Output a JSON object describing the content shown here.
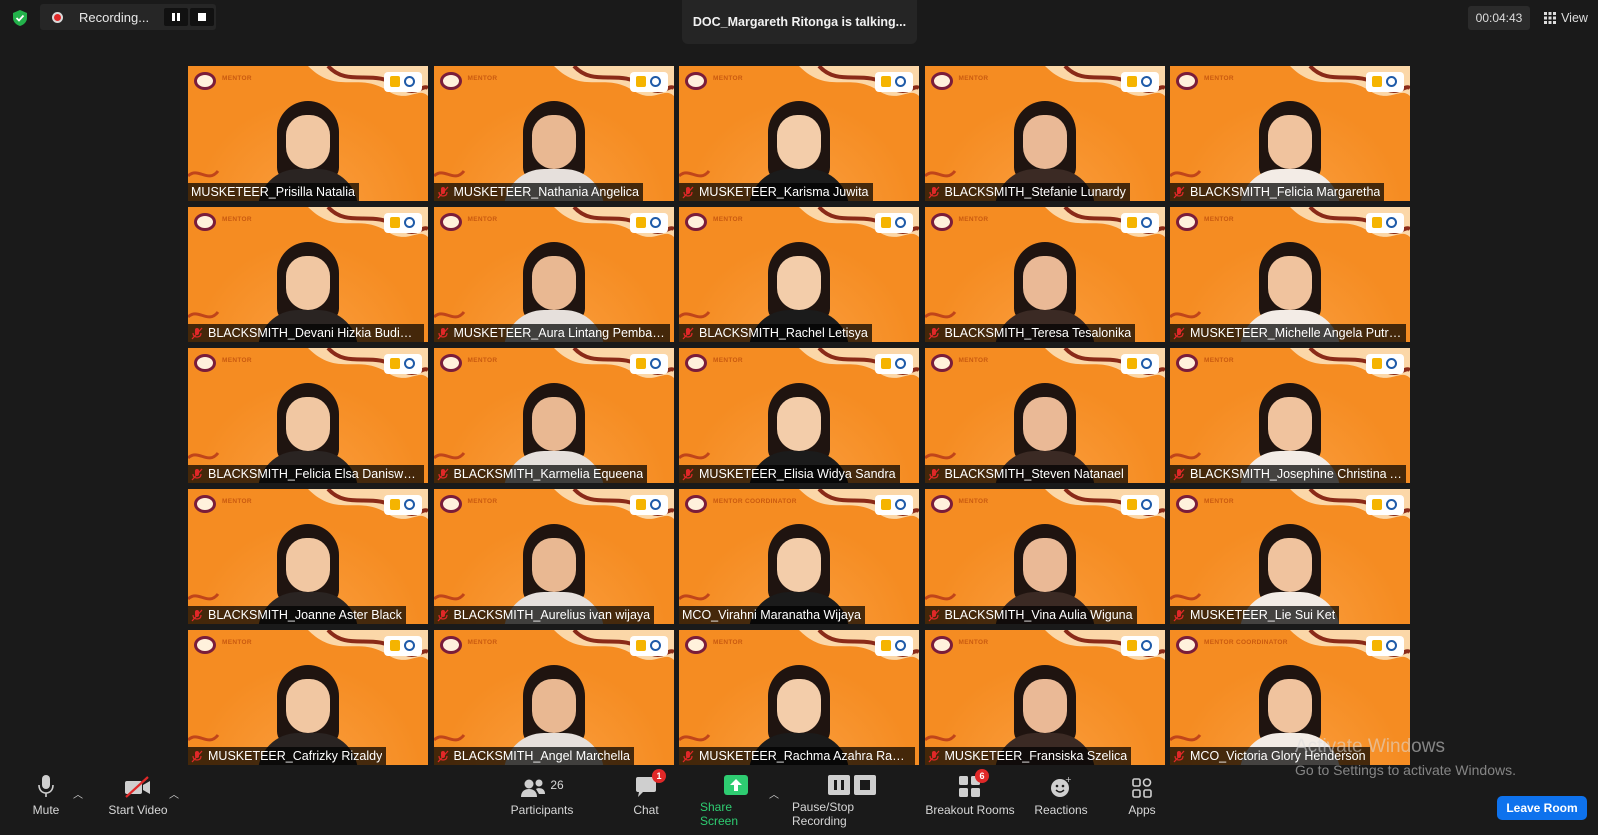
{
  "top_bar": {
    "recording_label": "Recording...",
    "talking_text": "DOC_Margareth Ritonga is talking...",
    "timer": "00:04:43",
    "view_label": "View"
  },
  "participants": [
    {
      "name": "MUSKETEER_Prisilla Natalia",
      "muted": false,
      "banner": "MENTOR"
    },
    {
      "name": "MUSKETEER_Nathania Angelica",
      "muted": true,
      "banner": "MENTOR"
    },
    {
      "name": "MUSKETEER_Karisma Juwita",
      "muted": true,
      "banner": "MENTOR"
    },
    {
      "name": "BLACKSMITH_Stefanie Lunardy",
      "muted": true,
      "banner": "MENTOR"
    },
    {
      "name": "BLACKSMITH_Felicia Margaretha",
      "muted": true,
      "banner": "MENTOR"
    },
    {
      "name": "BLACKSMITH_Devani Hizkia Budiman",
      "muted": true,
      "banner": "MENTOR"
    },
    {
      "name": "MUSKETEER_Aura Lintang Pembay...",
      "muted": true,
      "banner": "MENTOR"
    },
    {
      "name": "BLACKSMITH_Rachel Letisya",
      "muted": true,
      "banner": "MENTOR"
    },
    {
      "name": "BLACKSMITH_Teresa Tesalonika",
      "muted": true,
      "banner": "MENTOR"
    },
    {
      "name": "MUSKETEER_Michelle Angela Putri ...",
      "muted": true,
      "banner": "MENTOR"
    },
    {
      "name": "BLACKSMITH_Felicia Elsa Daniswara",
      "muted": true,
      "banner": "MENTOR"
    },
    {
      "name": "BLACKSMITH_Karmelia Equeena",
      "muted": true,
      "banner": "MENTOR"
    },
    {
      "name": "MUSKETEER_Elisia Widya Sandra",
      "muted": true,
      "banner": "MENTOR"
    },
    {
      "name": "BLACKSMITH_Steven Natanael",
      "muted": true,
      "banner": "MENTOR"
    },
    {
      "name": "BLACKSMITH_Josephine Christina A...",
      "muted": true,
      "banner": "MENTOR"
    },
    {
      "name": "BLACKSMITH_Joanne Aster Black",
      "muted": true,
      "banner": "MENTOR"
    },
    {
      "name": "BLACKSMITH_Aurelius ivan wijaya",
      "muted": true,
      "banner": "MENTOR"
    },
    {
      "name": "MCO_Virahni Maranatha Wijaya",
      "muted": false,
      "banner": "MENTOR COORDINATOR"
    },
    {
      "name": "BLACKSMITH_Vina Aulia Wiguna",
      "muted": true,
      "banner": "MENTOR"
    },
    {
      "name": "MUSKETEER_Lie Sui Ket",
      "muted": true,
      "banner": "MENTOR"
    },
    {
      "name": "MUSKETEER_Cafrizky Rizaldy",
      "muted": true,
      "banner": "MENTOR"
    },
    {
      "name": "BLACKSMITH_Angel Marchella",
      "muted": true,
      "banner": "MENTOR"
    },
    {
      "name": "MUSKETEER_Rachma Azahra Rama...",
      "muted": true,
      "banner": "MENTOR"
    },
    {
      "name": "MUSKETEER_Fransiska Szelica",
      "muted": true,
      "banner": "MENTOR"
    },
    {
      "name": "MCO_Victoria Glory Henderson",
      "muted": true,
      "banner": "MENTOR COORDINATOR"
    }
  ],
  "watermark": {
    "line1": "Activate Windows",
    "line2": "Go to Settings to activate Windows."
  },
  "toolbar": {
    "mute_label": "Mute",
    "start_video_label": "Start Video",
    "participants_label": "Participants",
    "participants_count": "26",
    "chat_label": "Chat",
    "chat_badge": "1",
    "share_label": "Share Screen",
    "recording_label": "Pause/Stop Recording",
    "breakout_label": "Breakout Rooms",
    "breakout_badge": "6",
    "reactions_label": "Reactions",
    "apps_label": "Apps",
    "leave_label": "Leave Room"
  },
  "colors": {
    "tile_bg": "#f58c22",
    "share_green": "#2ecc71",
    "leave_blue": "#0e72ed",
    "badge_red": "#e02828"
  }
}
